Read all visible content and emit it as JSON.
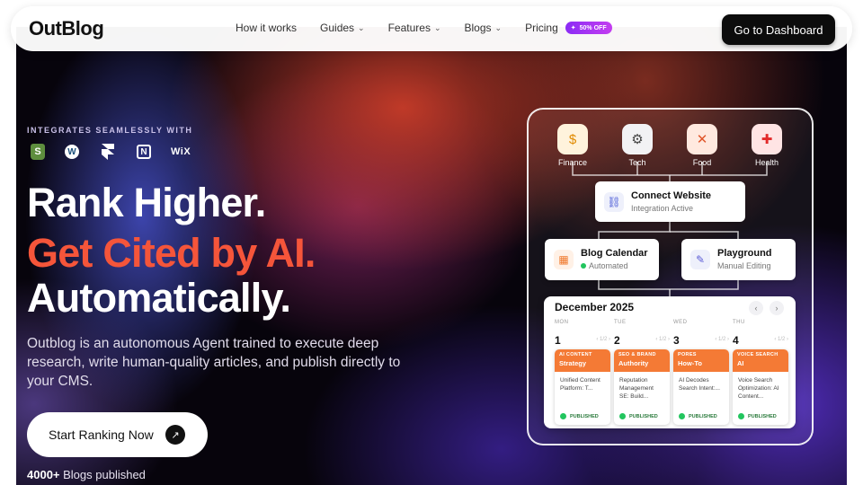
{
  "brand": {
    "name": "OutBlog"
  },
  "nav": {
    "links": [
      {
        "label": "How it works"
      },
      {
        "label": "Guides"
      },
      {
        "label": "Features"
      },
      {
        "label": "Blogs"
      },
      {
        "label": "Pricing"
      }
    ],
    "pricing_badge": "50% OFF",
    "dashboard_button": "Go to Dashboard"
  },
  "hero": {
    "integrations_label": "INTEGRATES SEAMLESSLY WITH",
    "integrations": [
      "shopify-icon",
      "wordpress-icon",
      "framer-icon",
      "notion-icon",
      "wix-icon"
    ],
    "wix_label": "WiX",
    "headline_1": "Rank Higher.",
    "headline_2": "Get Cited by AI.",
    "headline_3": "Automatically.",
    "description": "Outblog is an autonomous Agent trained to execute deep research, write human-quality articles, and publish directly to your CMS.",
    "cta": "Start Ranking Now",
    "count_number": "4000+",
    "count_text": " Blogs published",
    "accent_color": "#f5553a"
  },
  "panel": {
    "categories": [
      {
        "label": "Finance",
        "icon": "dollar-icon"
      },
      {
        "label": "Tech",
        "icon": "gear-icon"
      },
      {
        "label": "Food",
        "icon": "utensils-icon"
      },
      {
        "label": "Health",
        "icon": "health-cross-icon"
      }
    ],
    "connect": {
      "title": "Connect Website",
      "subtitle": "Integration Active"
    },
    "calendar_card": {
      "title": "Blog Calendar",
      "subtitle": "Automated"
    },
    "playground": {
      "title": "Playground",
      "subtitle": "Manual Editing"
    },
    "calendar": {
      "month": "December 2025",
      "days": [
        {
          "dow": "MON",
          "num": "1",
          "page": "‹ 1/2 ›",
          "category": "AI CONTENT",
          "title": "Strategy",
          "body": "Unified Content Platform: T...",
          "status": "PUBLISHED"
        },
        {
          "dow": "TUE",
          "num": "2",
          "page": "‹ 1/2 ›",
          "category": "SEO & BRAND",
          "title": "Authority",
          "body": "Reputation Management SE: Build...",
          "status": "PUBLISHED"
        },
        {
          "dow": "WED",
          "num": "3",
          "page": "‹ 1/2 ›",
          "category": "PORES",
          "title": "How-To",
          "body": "AI Decodes Search Intent:...",
          "status": "PUBLISHED"
        },
        {
          "dow": "THU",
          "num": "4",
          "page": "‹ 1/2 ›",
          "category": "VOICE SEARCH",
          "title": "AI",
          "body": "Voice Search Optimization: AI Content...",
          "status": "PUBLISHED"
        }
      ]
    }
  }
}
